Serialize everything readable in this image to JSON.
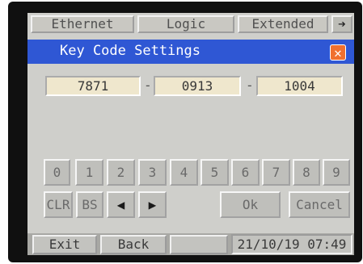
{
  "tabs": [
    {
      "label": "Ethernet"
    },
    {
      "label": "Logic"
    },
    {
      "label": "Extended"
    }
  ],
  "tab_arrow": {
    "label": "➔",
    "icon": "arrow-right-icon"
  },
  "dialog": {
    "title": "Key Code Settings",
    "close_label": "✕",
    "fields": [
      "7871",
      "0913",
      "1004"
    ],
    "separator": "-"
  },
  "keypad": {
    "digits": [
      "0",
      "1",
      "2",
      "3",
      "4",
      "5",
      "6",
      "7",
      "8",
      "9"
    ],
    "clr_label": "CLR",
    "bs_label": "BS",
    "left_label": "◀",
    "right_label": "▶",
    "ok_label": "Ok",
    "cancel_label": "Cancel"
  },
  "statusbar": {
    "exit_label": "Exit",
    "back_label": "Back",
    "datetime": "21/10/19 07:49"
  },
  "colors": {
    "title_bar": "#2f57d4",
    "close_button": "#f07030",
    "field_bg": "#efe7cd",
    "screen_bg": "#cfcfcb"
  }
}
